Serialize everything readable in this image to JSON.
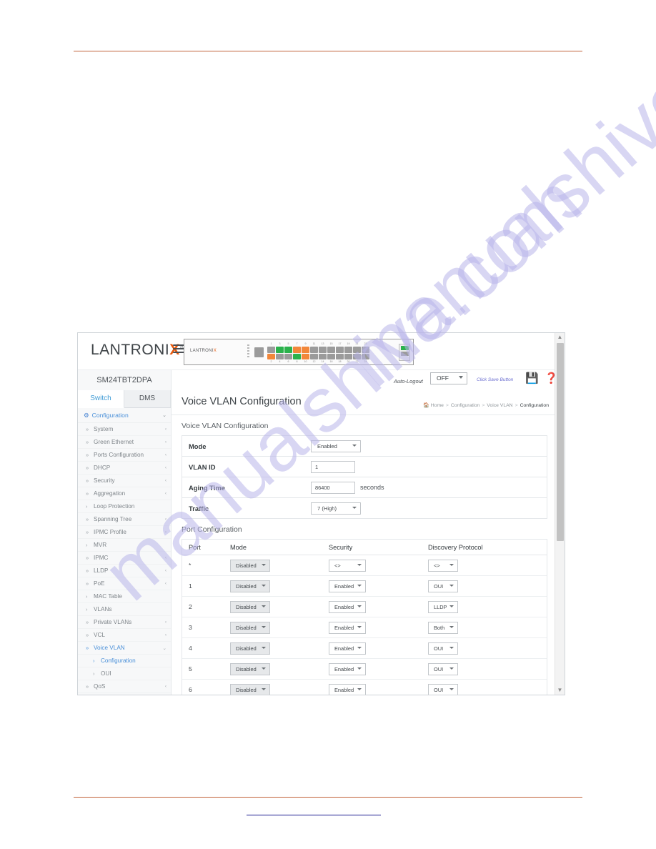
{
  "topbar": {
    "brand_left": "LANTRONI",
    "brand_x": "X",
    "brand_reg": "®",
    "hamburger": "menu-icon",
    "device_logo_left": "LANTRONI",
    "device_logo_x": "X"
  },
  "utilbar": {
    "auto_logout_label": "Auto-Logout",
    "auto_logout_value": "OFF",
    "save_hint": "Click Save Button",
    "save_icon": "save-icon",
    "help_icon": "help-icon",
    "logout_icon": "logout-icon"
  },
  "sidebar": {
    "model": "SM24TBT2DPA",
    "tabs": [
      {
        "label": "Switch",
        "active": true
      },
      {
        "label": "DMS",
        "active": false
      }
    ],
    "section": {
      "label": "Configuration",
      "chevron": "⌄"
    },
    "items": [
      {
        "label": "System",
        "mark": "»",
        "chev": "‹"
      },
      {
        "label": "Green Ethernet",
        "mark": "»",
        "chev": "‹"
      },
      {
        "label": "Ports Configuration",
        "mark": "»",
        "chev": "‹"
      },
      {
        "label": "DHCP",
        "mark": "»",
        "chev": "‹"
      },
      {
        "label": "Security",
        "mark": "»",
        "chev": "‹"
      },
      {
        "label": "Aggregation",
        "mark": "»",
        "chev": "‹"
      },
      {
        "label": "Loop Protection",
        "mark": "›",
        "chev": ""
      },
      {
        "label": "Spanning Tree",
        "mark": "»",
        "chev": "‹"
      },
      {
        "label": "IPMC Profile",
        "mark": "»",
        "chev": "‹"
      },
      {
        "label": "MVR",
        "mark": "›",
        "chev": ""
      },
      {
        "label": "IPMC",
        "mark": "»",
        "chev": "‹"
      },
      {
        "label": "LLDP",
        "mark": "»",
        "chev": "‹"
      },
      {
        "label": "PoE",
        "mark": "»",
        "chev": "‹"
      },
      {
        "label": "MAC Table",
        "mark": "›",
        "chev": ""
      },
      {
        "label": "VLANs",
        "mark": "›",
        "chev": ""
      },
      {
        "label": "Private VLANs",
        "mark": "»",
        "chev": "‹"
      },
      {
        "label": "VCL",
        "mark": "»",
        "chev": "‹"
      },
      {
        "label": "Voice VLAN",
        "mark": "»",
        "chev": "⌄",
        "active": true
      },
      {
        "label": "Configuration",
        "mark": "›",
        "chev": "",
        "sub": true,
        "active": true
      },
      {
        "label": "OUI",
        "mark": "›",
        "chev": "",
        "sub": true
      },
      {
        "label": "QoS",
        "mark": "»",
        "chev": "‹"
      }
    ]
  },
  "page": {
    "title": "Voice VLAN Configuration",
    "breadcrumb": {
      "home_icon": "home-icon",
      "home": "Home",
      "items": [
        "Configuration",
        "Voice VLAN"
      ],
      "current": "Configuration",
      "separator": ">"
    }
  },
  "voice_vlan": {
    "card_title": "Voice VLAN Configuration",
    "rows": [
      {
        "label": "Mode",
        "type": "select",
        "value": "Enabled"
      },
      {
        "label": "VLAN ID",
        "type": "text",
        "value": "1"
      },
      {
        "label": "Aging Time",
        "type": "text",
        "value": "86400",
        "unit": "seconds"
      },
      {
        "label": "Traffic",
        "type": "select",
        "value": "7 (High)"
      }
    ]
  },
  "port_config": {
    "card_title": "Port Configuration",
    "columns": [
      "Port",
      "Mode",
      "Security",
      "Discovery Protocol"
    ],
    "rows": [
      {
        "port": "*",
        "mode": "Disabled",
        "security": "<>",
        "discovery": "<>"
      },
      {
        "port": "1",
        "mode": "Disabled",
        "security": "Enabled",
        "discovery": "OUI"
      },
      {
        "port": "2",
        "mode": "Disabled",
        "security": "Enabled",
        "discovery": "LLDP"
      },
      {
        "port": "3",
        "mode": "Disabled",
        "security": "Enabled",
        "discovery": "Both"
      },
      {
        "port": "4",
        "mode": "Disabled",
        "security": "Enabled",
        "discovery": "OUI"
      },
      {
        "port": "5",
        "mode": "Disabled",
        "security": "Enabled",
        "discovery": "OUI"
      },
      {
        "port": "6",
        "mode": "Disabled",
        "security": "Enabled",
        "discovery": "OUI"
      }
    ]
  },
  "device_ports": {
    "top_numbers": [
      "1",
      "3",
      "5",
      "7",
      "9",
      "11",
      "13",
      "15",
      "17",
      "19",
      "21",
      "23"
    ],
    "bottom_numbers": [
      "2",
      "4",
      "6",
      "8",
      "10",
      "12",
      "14",
      "16",
      "18",
      "20",
      "22",
      "24"
    ],
    "top_states": [
      "gray",
      "green",
      "green",
      "orange",
      "orange",
      "gray",
      "gray",
      "gray",
      "gray",
      "gray",
      "gray",
      "gray"
    ],
    "bottom_states": [
      "orange",
      "gray",
      "gray",
      "green",
      "orange",
      "gray",
      "gray",
      "gray",
      "gray",
      "gray",
      "gray",
      "gray"
    ]
  },
  "watermark": {
    "text": "manualshive.com"
  },
  "colors": {
    "accent_orange": "#e8590c",
    "link_blue": "#4a90d9",
    "rule_orange": "#c1633a",
    "led_green": "#2bb24c",
    "led_orange": "#f2873a"
  }
}
